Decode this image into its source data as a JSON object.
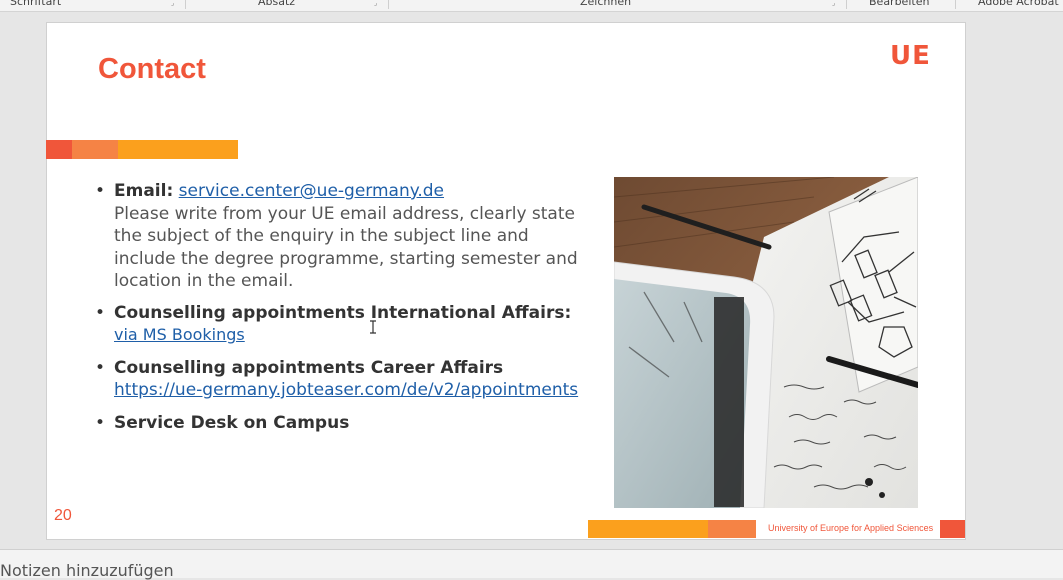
{
  "ribbon": {
    "groups": [
      "Schriftart",
      "Absatz",
      "Zeichnen",
      "Bearbeiten",
      "Adobe Acrobat"
    ]
  },
  "slide": {
    "title": "Contact",
    "logo": "UE",
    "page_number": "20",
    "footer": "University of Europe for Applied Sciences",
    "bullets": {
      "email_label": "Email:",
      "email_link": "service.center@ue-germany.de",
      "email_text": "Please write from your UE email address, clearly state the subject of the enquiry in the subject line and include the degree programme, starting semester and location in the email.",
      "international_label": "Counselling appointments International Affairs:",
      "international_link": "via MS Bookings",
      "career_label": "Counselling appointments Career Affairs",
      "career_link": "https://ue-germany.jobteaser.com/de/v2/appointments",
      "service_desk_label": "Service Desk on Campus"
    },
    "accent_colors": [
      "#f0563a",
      "#f58345",
      "#fba01d"
    ]
  },
  "notes": {
    "placeholder": "Notizen hinzuzufügen"
  }
}
